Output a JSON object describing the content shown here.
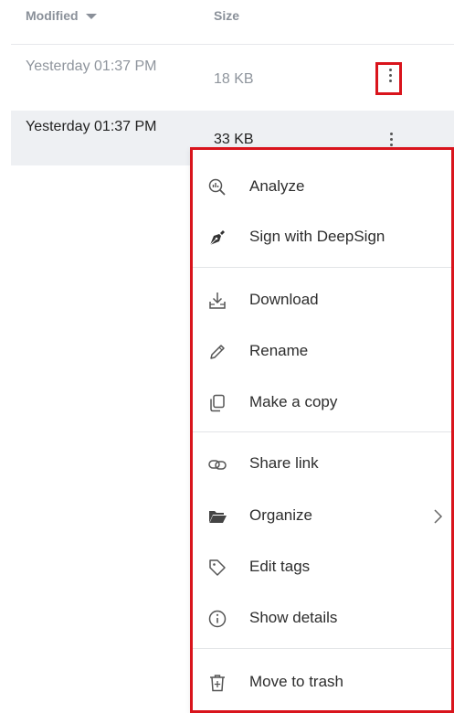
{
  "header": {
    "modified_label": "Modified",
    "size_label": "Size"
  },
  "rows": [
    {
      "modified": "Yesterday 01:37 PM",
      "size": "18 KB"
    },
    {
      "modified": "Yesterday 01:37 PM",
      "size": "33 KB"
    }
  ],
  "menu": {
    "analyze": "Analyze",
    "sign": "Sign with DeepSign",
    "download": "Download",
    "rename": "Rename",
    "copy": "Make a copy",
    "share": "Share link",
    "organize": "Organize",
    "tags": "Edit tags",
    "details": "Show details",
    "trash": "Move to trash"
  },
  "colors": {
    "highlight": "#d9141c",
    "selected_row": "#eef0f3"
  }
}
